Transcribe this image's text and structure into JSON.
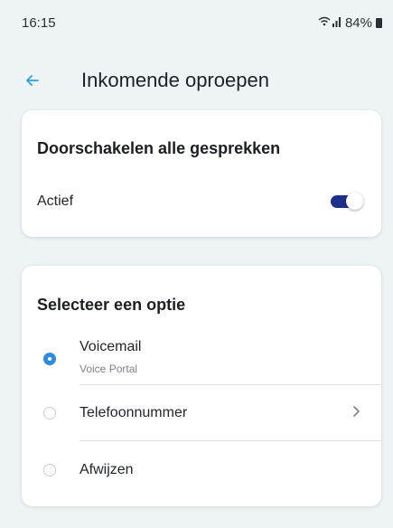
{
  "status_bar": {
    "time": "16:15",
    "signal_icons": "wifi-signal-icons",
    "battery_percent": "84%"
  },
  "header": {
    "back_icon": "back-arrow-icon",
    "title": "Inkomende oproepen"
  },
  "forward_card": {
    "title": "Doorschakelen alle gesprekken",
    "toggle_label": "Actief",
    "toggle_on": true
  },
  "options_card": {
    "title": "Selecteer een optie",
    "options": [
      {
        "label": "Voicemail",
        "sublabel": "Voice Portal",
        "selected": true
      },
      {
        "label": "Telefoonnummer",
        "selected": false,
        "has_chevron": true
      },
      {
        "label": "Afwijzen",
        "selected": false
      }
    ]
  },
  "colors": {
    "accent": "#2ba1d8",
    "toggle_on": "#1e2e8c",
    "radio_selected": "#2f8be0",
    "background": "#eef4f6"
  }
}
